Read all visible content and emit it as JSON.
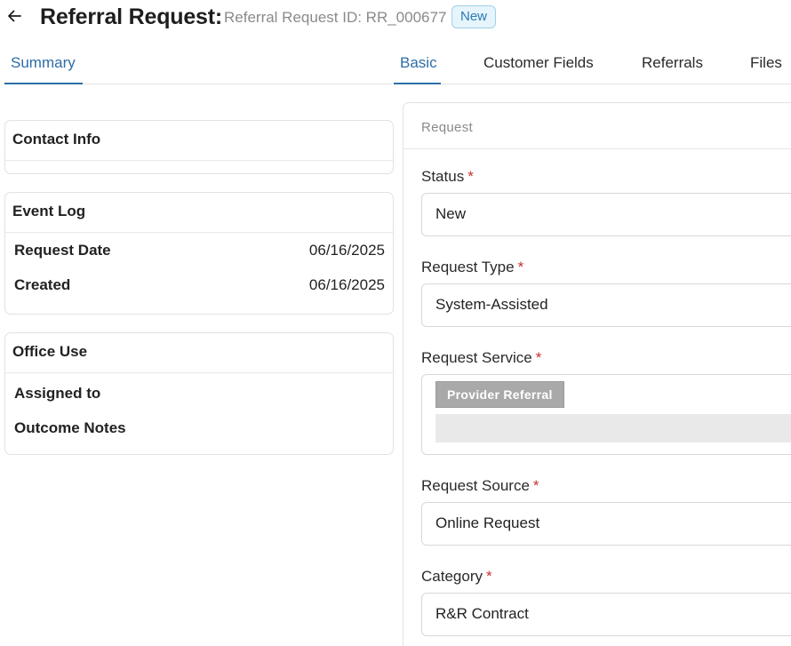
{
  "header": {
    "title": "Referral Request:",
    "request_id": "Referral Request ID: RR_000677",
    "status_badge": "New"
  },
  "tabs_left": {
    "summary": "Summary"
  },
  "tabs_right": {
    "basic": "Basic",
    "customer_fields": "Customer Fields",
    "referrals": "Referrals",
    "files": "Files"
  },
  "contact_info": {
    "title": "Contact Info"
  },
  "event_log": {
    "title": "Event Log",
    "rows": [
      {
        "label": "Request Date",
        "value": "06/16/2025"
      },
      {
        "label": "Created",
        "value": "06/16/2025"
      }
    ]
  },
  "office_use": {
    "title": "Office Use",
    "rows": [
      {
        "label": "Assigned to",
        "value": ""
      },
      {
        "label": "Outcome Notes",
        "value": ""
      }
    ]
  },
  "request_form": {
    "section_title": "Request",
    "required_mark": "*",
    "status": {
      "label": "Status",
      "value": "New"
    },
    "request_type": {
      "label": "Request Type",
      "value": "System-Assisted"
    },
    "request_service": {
      "label": "Request Service",
      "chips": [
        "Provider Referral"
      ]
    },
    "request_source": {
      "label": "Request Source",
      "value": "Online Request"
    },
    "category": {
      "label": "Category",
      "value": "R&R Contract"
    }
  },
  "colors": {
    "accent": "#2d6da6",
    "required": "#c8302f",
    "badge_bg": "#e6f4fb",
    "badge_border": "#9fd1ea",
    "chip_bg": "#a9a9a9"
  },
  "icons": {
    "back": "arrow-left-icon"
  }
}
